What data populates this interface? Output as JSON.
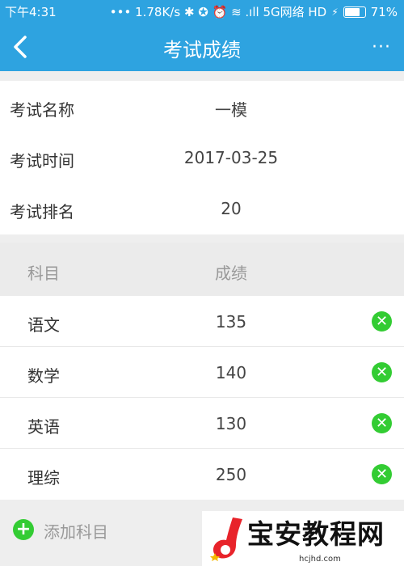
{
  "status_bar": {
    "time": "下午4:31",
    "right_text": "••• 1.78K/s ✱ ✪ ⏰ ≋ .ıll 5G网络 HD",
    "battery": "71%",
    "battery_level": 0.71
  },
  "nav": {
    "title": "考试成绩",
    "back_icon": "chevron-left-icon",
    "more_label": "···"
  },
  "info": {
    "rows": [
      {
        "label": "考试名称",
        "value": "一模"
      },
      {
        "label": "考试时间",
        "value": "2017-03-25"
      },
      {
        "label": "考试排名",
        "value": "20"
      }
    ]
  },
  "table": {
    "headers": [
      "科目",
      "成绩"
    ],
    "rows": [
      {
        "subject": "语文",
        "score": "135"
      },
      {
        "subject": "数学",
        "score": "140"
      },
      {
        "subject": "英语",
        "score": "130"
      },
      {
        "subject": "理综",
        "score": "250"
      }
    ],
    "delete_icon": "close-circle-icon"
  },
  "add_subject": {
    "label": "添加科目",
    "icon": "plus-circle-icon"
  },
  "watermark": {
    "text": "宝安教程网",
    "url": "hcjhd.com"
  },
  "colors": {
    "accent": "#2ea3e0",
    "green": "#33cc33"
  }
}
